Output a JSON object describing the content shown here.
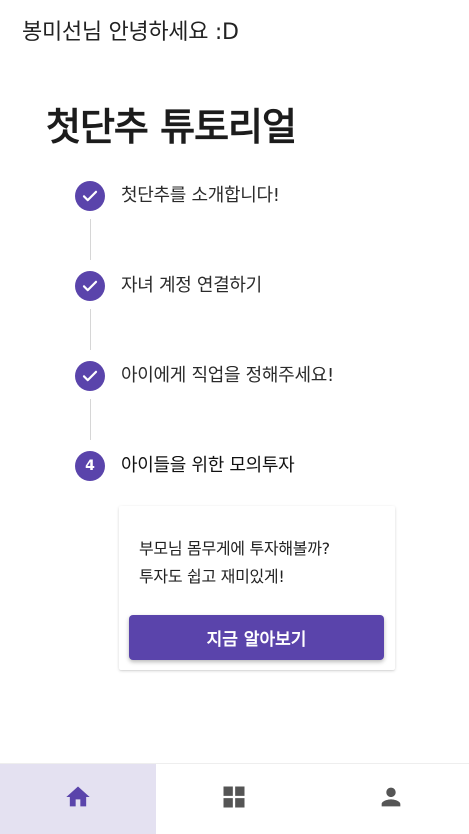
{
  "header": {
    "greeting": "봉미선님 안녕하세요 :D"
  },
  "main": {
    "title": "첫단추 튜토리얼",
    "steps": [
      {
        "status": "completed",
        "label": "첫단추를 소개합니다!"
      },
      {
        "status": "completed",
        "label": "자녀 계정 연결하기"
      },
      {
        "status": "completed",
        "label": "아이에게 직업을 정해주세요!"
      },
      {
        "status": "active",
        "number": "4",
        "label": "아이들을 위한 모의투자"
      }
    ],
    "card": {
      "line1": "부모님 몸무게에 투자해볼까?",
      "line2": "투자도 쉽고 재미있게!",
      "button_label": "지금 알아보기"
    }
  },
  "bottom_nav": {
    "items": [
      {
        "icon": "home-icon",
        "selected": true
      },
      {
        "icon": "dashboard-icon",
        "selected": false
      },
      {
        "icon": "person-icon",
        "selected": false
      }
    ]
  },
  "colors": {
    "accent": "#5a44ab",
    "nav_selected_bg": "#e4e1f1",
    "nav_icon_selected": "#5a44ab",
    "nav_icon": "#555555"
  }
}
